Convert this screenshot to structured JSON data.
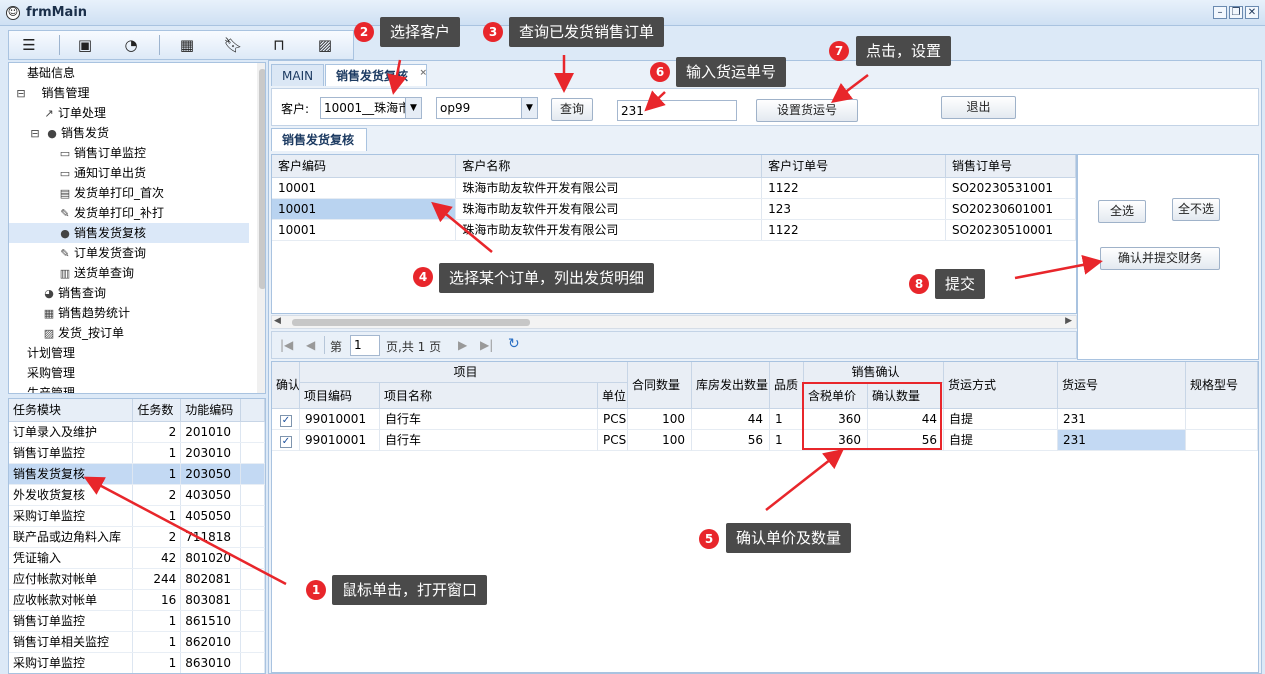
{
  "window": {
    "title": "frmMain",
    "icon": "app-icon",
    "controls": [
      "minimize-icon",
      "restore-icon",
      "close-icon"
    ]
  },
  "toolbar": {
    "icons": [
      "menu-icon",
      "briefcase-icon",
      "rss-icon",
      "calendar-icon",
      "bookmark-icon",
      "inbox-icon",
      "image-icon"
    ]
  },
  "tree": {
    "items": [
      {
        "label": "基础信息",
        "icon": ""
      },
      {
        "label": "销售管理",
        "icon": "collapse-icon"
      },
      {
        "label": "订单处理",
        "icon": "chart-line-icon"
      },
      {
        "label": "销售发货",
        "icon": "user-icon"
      },
      {
        "label": "销售订单监控",
        "icon": "monitor-icon"
      },
      {
        "label": "通知订单出货",
        "icon": "monitor-icon"
      },
      {
        "label": "发货单打印_首次",
        "icon": "save-icon"
      },
      {
        "label": "发货单打印_补打",
        "icon": "edit-icon"
      },
      {
        "label": "销售发货复核",
        "icon": "user-icon"
      },
      {
        "label": "订单发货查询",
        "icon": "edit-icon"
      },
      {
        "label": "送货单查询",
        "icon": "bar-chart-icon"
      },
      {
        "label": "销售查询",
        "icon": "pie-chart-icon"
      },
      {
        "label": "销售趋势统计",
        "icon": "calendar-icon"
      },
      {
        "label": "发货_按订单",
        "icon": "image-icon"
      },
      {
        "label": "计划管理",
        "icon": ""
      },
      {
        "label": "采购管理",
        "icon": ""
      },
      {
        "label": "生产管理",
        "icon": ""
      }
    ]
  },
  "tasks": {
    "headers": [
      "任务模块",
      "任务数",
      "功能编码"
    ],
    "rows": [
      [
        "订单录入及维护",
        "2",
        "201010"
      ],
      [
        "销售订单监控",
        "1",
        "203010"
      ],
      [
        "销售发货复核",
        "1",
        "203050"
      ],
      [
        "外发收货复核",
        "2",
        "403050"
      ],
      [
        "采购订单监控",
        "1",
        "405050"
      ],
      [
        "联产品或边角料入库",
        "2",
        "711818"
      ],
      [
        "凭证输入",
        "42",
        "801020"
      ],
      [
        "应付帐款对帐单",
        "244",
        "802081"
      ],
      [
        "应收帐款对帐单",
        "16",
        "803081"
      ],
      [
        "销售订单监控",
        "1",
        "861510"
      ],
      [
        "销售订单相关监控",
        "1",
        "862010"
      ],
      [
        "采购订单监控",
        "1",
        "863010"
      ]
    ]
  },
  "tabs": [
    {
      "label": "MAIN"
    },
    {
      "label": "销售发货复核"
    }
  ],
  "tab_close": "×",
  "query": {
    "customer_label": "客户:",
    "customer_value": "10001__珠海市",
    "operator_value": "op99",
    "query_button": "查询",
    "tracking_value": "231",
    "set_tracking_button": "设置货运号",
    "exit_button": "退出"
  },
  "subtab": {
    "label": "销售发货复核"
  },
  "orders": {
    "headers": [
      "客户编码",
      "客户名称",
      "客户订单号",
      "销售订单号"
    ],
    "rows": [
      [
        "10001",
        "珠海市助友软件开发有限公司",
        "1122",
        "SO20230531001"
      ],
      [
        "10001",
        "珠海市助友软件开发有限公司",
        "123",
        "SO20230601001"
      ],
      [
        "10001",
        "珠海市助友软件开发有限公司",
        "1122",
        "SO20230510001"
      ]
    ]
  },
  "pager": {
    "prefix": "第",
    "page": "1",
    "suffix": "页,共 1 页"
  },
  "side": {
    "select_all": "全选",
    "select_none": "全不选",
    "submit": "确认并提交财务"
  },
  "details": {
    "group_item": "项目",
    "group_confirm": "销售确认",
    "headers": {
      "confirm": "确认",
      "item_code": "项目编码",
      "item_name": "项目名称",
      "unit": "单位",
      "contract_qty": "合同数量",
      "shipped_qty": "库房发出数量",
      "quality": "品质",
      "tax_price": "含税单价",
      "confirm_qty": "确认数量",
      "ship_method": "货运方式",
      "tracking_no": "货运号",
      "spec": "规格型号"
    },
    "rows": [
      {
        "checked": true,
        "item_code": "99010001",
        "item_name": "自行车",
        "unit": "PCS",
        "contract_qty": "100",
        "shipped_qty": "44",
        "quality": "1",
        "tax_price": "360",
        "confirm_qty": "44",
        "ship_method": "自提",
        "tracking_no": "231",
        "spec": ""
      },
      {
        "checked": true,
        "item_code": "99010001",
        "item_name": "自行车",
        "unit": "PCS",
        "contract_qty": "100",
        "shipped_qty": "56",
        "quality": "1",
        "tax_price": "360",
        "confirm_qty": "56",
        "ship_method": "自提",
        "tracking_no": "231",
        "spec": ""
      }
    ]
  },
  "annotations": [
    {
      "num": "1",
      "text": "鼠标单击，打开窗口"
    },
    {
      "num": "2",
      "text": "选择客户"
    },
    {
      "num": "3",
      "text": "查询已发货销售订单"
    },
    {
      "num": "4",
      "text": "选择某个订单，列出发货明细"
    },
    {
      "num": "5",
      "text": "确认单价及数量"
    },
    {
      "num": "6",
      "text": "输入货运单号"
    },
    {
      "num": "7",
      "text": "点击，设置"
    },
    {
      "num": "8",
      "text": "提交"
    }
  ],
  "colors": {
    "accent_red": "#e8262b",
    "callout_bg": "#4a4a4a",
    "header_bg": "#e9eef5",
    "selection": "#b9d3f0"
  }
}
